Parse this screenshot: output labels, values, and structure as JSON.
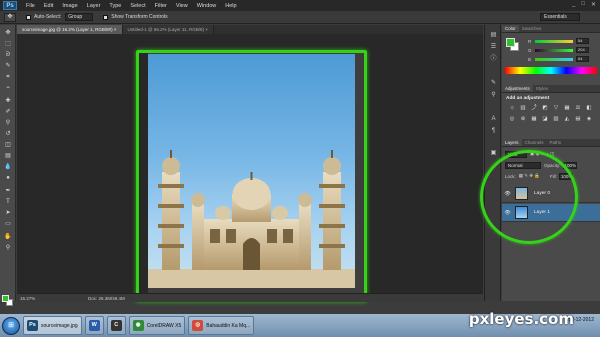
{
  "app": {
    "logo": "Ps"
  },
  "menubar": [
    "File",
    "Edit",
    "Image",
    "Layer",
    "Type",
    "Select",
    "Filter",
    "View",
    "Window",
    "Help"
  ],
  "window_controls": {
    "minimize": "_",
    "maximize": "□",
    "close": "✕"
  },
  "options_bar": {
    "auto_select_label": "Auto-Select:",
    "auto_select_value": "Group",
    "transform_label": "Show Transform Controls",
    "workspace": "Essentials"
  },
  "doc_tabs": [
    {
      "label": "sourceimage.jpg @ 16.2% (Layer 1, RGB/8#) ×",
      "active": true
    },
    {
      "label": "Untitled-1 @ 66.2% (Layer 11, RGB/8) ×",
      "active": false
    }
  ],
  "status": {
    "zoom": "16.27%",
    "doc": "Doc: 26.3M/49.4M"
  },
  "color_panel": {
    "tabs": [
      "Color",
      "Swatches"
    ],
    "sliders": [
      {
        "label": "R",
        "value": "54"
      },
      {
        "label": "G",
        "value": "204"
      },
      {
        "label": "B",
        "value": "54"
      }
    ],
    "foreground": "#2fbf2f"
  },
  "adjustments_panel": {
    "tabs": [
      "Adjustments",
      "Styles"
    ],
    "title": "Add an adjustment",
    "icons": [
      "brightness-icon",
      "levels-icon",
      "curves-icon",
      "exposure-icon",
      "vibrance-icon",
      "hue-icon",
      "balance-icon",
      "bw-icon",
      "photo-filter-icon",
      "channel-mixer-icon",
      "color-lookup-icon",
      "invert-icon",
      "posterize-icon",
      "threshold-icon",
      "gradient-map-icon",
      "selective-color-icon"
    ]
  },
  "layers_panel": {
    "tabs": [
      "Layers",
      "Channels",
      "Paths"
    ],
    "kind": "Kind",
    "blend_mode": "Normal",
    "opacity_label": "Opacity:",
    "opacity": "100%",
    "lock_label": "Lock:",
    "fill_label": "Fill:",
    "fill": "100%",
    "layers": [
      {
        "name": "Layer 0",
        "selected": false
      },
      {
        "name": "Layer 1",
        "selected": true
      }
    ]
  },
  "taskbar": {
    "start": "⊞",
    "items": [
      {
        "label": "sourceimage.jpg",
        "icon": "Ps",
        "active": true
      },
      {
        "label": "",
        "icon": "W",
        "active": false
      },
      {
        "label": "",
        "icon": "C",
        "active": false
      },
      {
        "label": "CorelDRAW X5",
        "icon": "◉",
        "active": false
      },
      {
        "label": "Bahauddin Ka Mq...",
        "icon": "◎",
        "active": false
      }
    ],
    "time": "",
    "date": "12-12-2012"
  },
  "watermark": "pxleyes.com"
}
